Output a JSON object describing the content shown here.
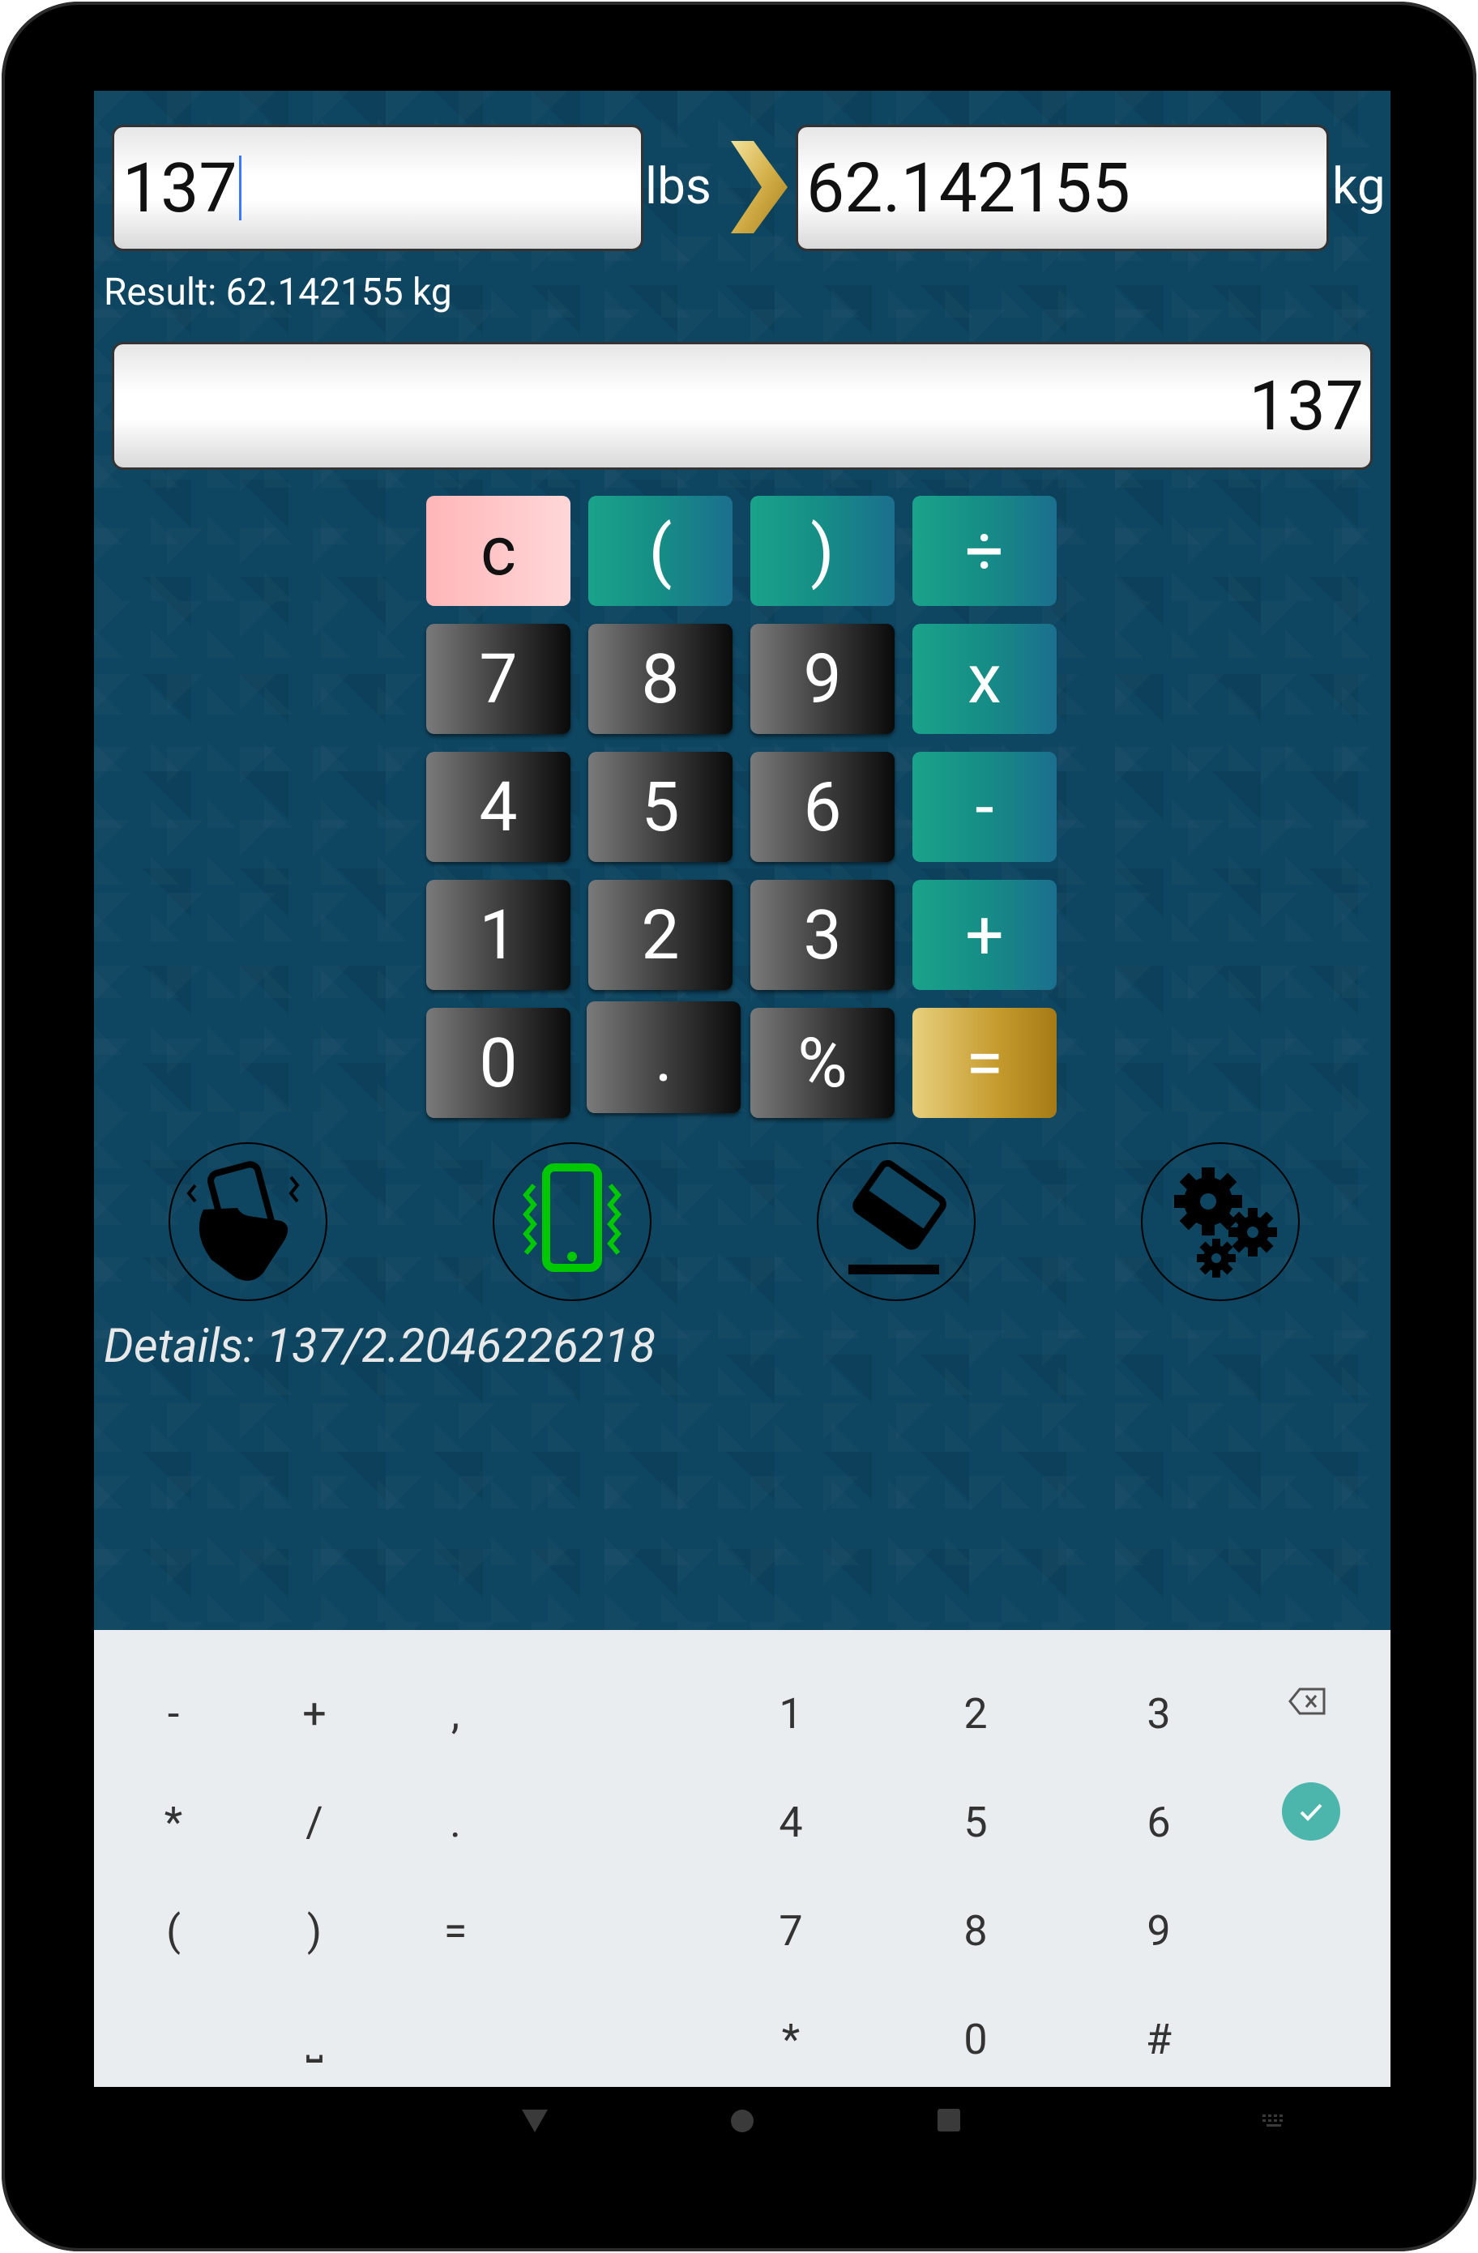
{
  "converter": {
    "input_value": "137",
    "unit_from": "lbs",
    "output_value": "62.142155",
    "unit_to": "kg",
    "result_text": "Result: 62.142155 kg"
  },
  "calculator": {
    "display": "137",
    "keys": [
      {
        "label": "c",
        "style": "clear",
        "name": "clear-key",
        "col": 0,
        "row": 0
      },
      {
        "label": "(",
        "style": "op",
        "name": "open-paren-key",
        "col": 1,
        "row": 0
      },
      {
        "label": ")",
        "style": "op",
        "name": "close-paren-key",
        "col": 2,
        "row": 0
      },
      {
        "label": "÷",
        "style": "op",
        "name": "divide-key",
        "col": 3,
        "row": 0
      },
      {
        "label": "7",
        "style": "dark",
        "name": "digit-7-key",
        "col": 0,
        "row": 1
      },
      {
        "label": "8",
        "style": "dark",
        "name": "digit-8-key",
        "col": 1,
        "row": 1
      },
      {
        "label": "9",
        "style": "dark",
        "name": "digit-9-key",
        "col": 2,
        "row": 1
      },
      {
        "label": "x",
        "style": "op",
        "name": "multiply-key",
        "col": 3,
        "row": 1
      },
      {
        "label": "4",
        "style": "dark",
        "name": "digit-4-key",
        "col": 0,
        "row": 2
      },
      {
        "label": "5",
        "style": "dark",
        "name": "digit-5-key",
        "col": 1,
        "row": 2
      },
      {
        "label": "6",
        "style": "dark",
        "name": "digit-6-key",
        "col": 2,
        "row": 2
      },
      {
        "label": "-",
        "style": "op",
        "name": "subtract-key",
        "col": 3,
        "row": 2
      },
      {
        "label": "1",
        "style": "dark",
        "name": "digit-1-key",
        "col": 0,
        "row": 3
      },
      {
        "label": "2",
        "style": "dark",
        "name": "digit-2-key",
        "col": 1,
        "row": 3
      },
      {
        "label": "3",
        "style": "dark",
        "name": "digit-3-key",
        "col": 2,
        "row": 3
      },
      {
        "label": "+",
        "style": "op",
        "name": "add-key",
        "col": 3,
        "row": 3
      },
      {
        "label": "0",
        "style": "dark",
        "name": "digit-0-key",
        "col": 0,
        "row": 4
      },
      {
        "label": ".",
        "style": "dark",
        "name": "decimal-key",
        "col": 1,
        "row": 4
      },
      {
        "label": "%",
        "style": "dark",
        "name": "percent-key",
        "col": 2,
        "row": 4
      },
      {
        "label": "=",
        "style": "eq",
        "name": "equals-key",
        "col": 3,
        "row": 4
      }
    ]
  },
  "tools": [
    {
      "icon": "shake-phone-icon",
      "name": "shake-button"
    },
    {
      "icon": "vibrate-icon",
      "name": "vibrate-toggle"
    },
    {
      "icon": "eraser-icon",
      "name": "eraser-button"
    },
    {
      "icon": "gears-icon",
      "name": "settings-button"
    }
  ],
  "details_text": "Details: 137/2.2046226218",
  "soft_keyboard": {
    "keys": [
      {
        "label": "-",
        "name": "kbd-minus"
      },
      {
        "label": "+",
        "name": "kbd-plus"
      },
      {
        "label": ",",
        "name": "kbd-comma"
      },
      {
        "label": "1",
        "name": "kbd-1"
      },
      {
        "label": "2",
        "name": "kbd-2"
      },
      {
        "label": "3",
        "name": "kbd-3"
      },
      {
        "label": "*",
        "name": "kbd-asterisk"
      },
      {
        "label": "/",
        "name": "kbd-slash"
      },
      {
        "label": ".",
        "name": "kbd-period"
      },
      {
        "label": "4",
        "name": "kbd-4"
      },
      {
        "label": "5",
        "name": "kbd-5"
      },
      {
        "label": "6",
        "name": "kbd-6"
      },
      {
        "label": "(",
        "name": "kbd-open-paren"
      },
      {
        "label": ")",
        "name": "kbd-close-paren"
      },
      {
        "label": "=",
        "name": "kbd-equals"
      },
      {
        "label": "7",
        "name": "kbd-7"
      },
      {
        "label": "8",
        "name": "kbd-8"
      },
      {
        "label": "9",
        "name": "kbd-9"
      },
      {
        "label": "⎵",
        "name": "kbd-space"
      },
      {
        "label": "*",
        "name": "kbd-star"
      },
      {
        "label": "0",
        "name": "kbd-0"
      },
      {
        "label": "#",
        "name": "kbd-hash"
      }
    ],
    "backspace_icon": "backspace-icon",
    "done_icon": "check-icon"
  },
  "colors": {
    "app_background": "#0e4560",
    "operator_key": "#1aa38a",
    "equals_key": "#c59a2c",
    "clear_key": "#ffc6c8",
    "done_button": "#4db6ac",
    "vibrate_icon": "#00c800"
  },
  "nav_bar": {
    "back_icon": "back-triangle-icon",
    "home_icon": "home-circle-icon",
    "recents_icon": "recents-square-icon",
    "keyboard_icon": "keyboard-switch-icon"
  }
}
